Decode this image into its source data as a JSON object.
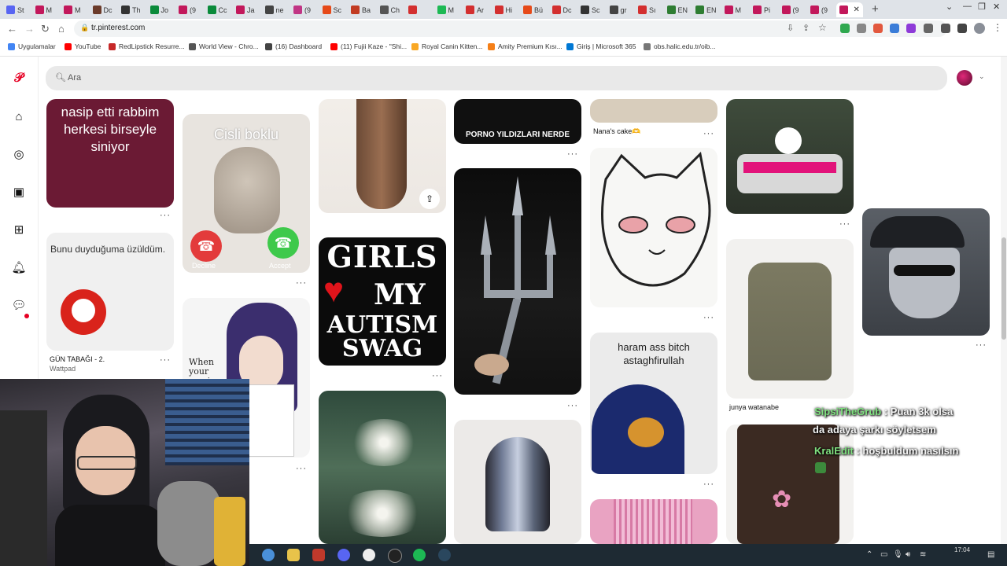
{
  "browser": {
    "tabs": [
      "St",
      "M",
      "M",
      "Dc",
      "Th",
      "Jo",
      "(9",
      "Cc",
      "Ja",
      "ne",
      "(9",
      "Sc",
      "Ba",
      "Ch",
      "",
      "M",
      "Ar",
      "Hi",
      "Bü",
      "Dc",
      "Sc",
      "gr",
      "Sı",
      "EN",
      "EN",
      "M",
      "Pi",
      "(9",
      "(9",
      ""
    ],
    "active_tab_index": 29,
    "url": "tr.pinterest.com",
    "bookmarks": [
      "Uygulamalar",
      "YouTube",
      "RedLipstick Resurre...",
      "World View - Chro...",
      "(16) Dashboard",
      "(11) Fujii Kaze - \"Shi...",
      "Royal Canin Kitten...",
      "Amity Premium Kısı...",
      "Giriş | Microsoft 365",
      "obs.halic.edu.tr/oib..."
    ]
  },
  "pinterest": {
    "search_placeholder": "Ara",
    "pins": {
      "p1_text": "nasip etti rabbim herkesi birseyle siniyor",
      "p2_text": "Bunu duyduğuma üzüldüm.",
      "p2_caption": "GÜN TABAĞI - 2.",
      "p2_sub": "Wattpad",
      "p3_text": "Cisli boklu",
      "p3_decline": "Decline",
      "p3_accept": "Accept",
      "p4_text": "When your age is getting",
      "p5_line1": "GIRLS",
      "p5_line2": "MY",
      "p5_line3": "AUTISM",
      "p5_line4": "SWAG",
      "p6_text": "PORNO YILDIZLARI NERDE",
      "p7_caption": "Nana's cake🫶",
      "p8_text": "haram ass bitch astaghfirullah",
      "p9_caption": "junya watanabe"
    }
  },
  "chat": [
    {
      "user": "SipsiTheGrub",
      "message": "Puan 3k olsa"
    },
    {
      "user": "",
      "message": "da adaya şarkı söyletsem"
    },
    {
      "user": "KralEdit",
      "message": "hoşbuldum nasılsın"
    }
  ],
  "taskbar": {
    "time": "17:04"
  }
}
